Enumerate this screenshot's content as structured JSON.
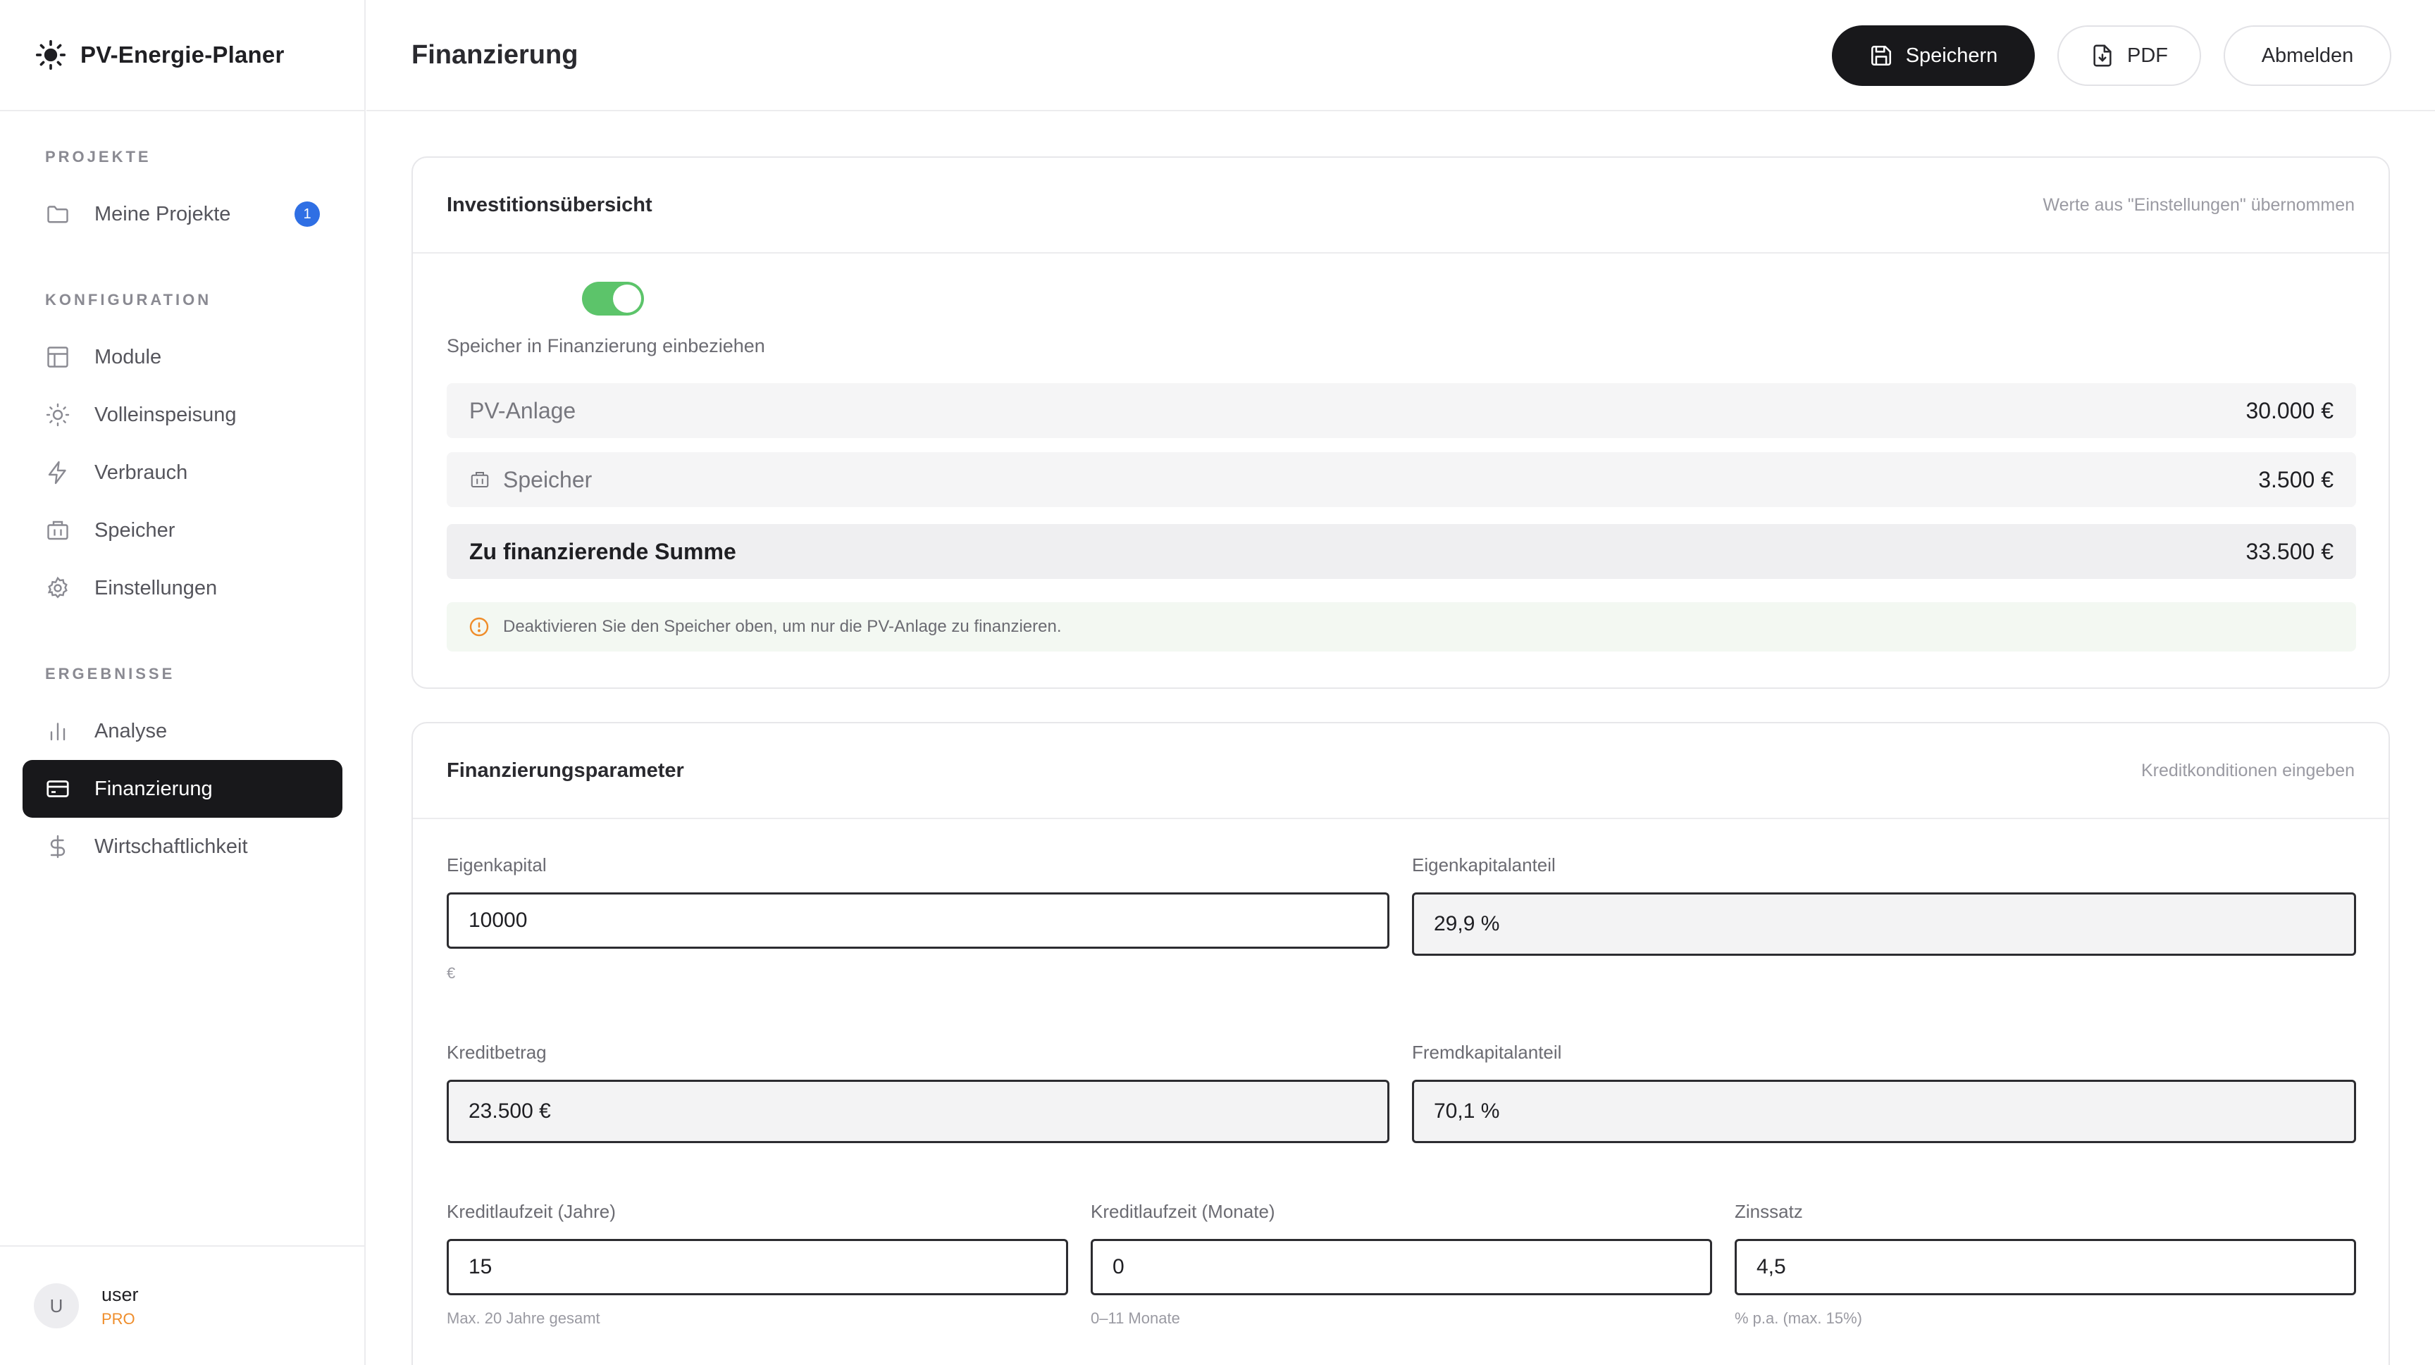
{
  "app": {
    "name": "PV-Energie-Planer"
  },
  "sidebar": {
    "sections": [
      {
        "label": "PROJEKTE"
      },
      {
        "label": "KONFIGURATION"
      },
      {
        "label": "ERGEBNISSE"
      }
    ],
    "items": [
      {
        "label": "Meine Projekte",
        "badge": "1"
      },
      {
        "label": "Module"
      },
      {
        "label": "Volleinspeisung"
      },
      {
        "label": "Verbrauch"
      },
      {
        "label": "Speicher"
      },
      {
        "label": "Einstellungen"
      },
      {
        "label": "Analyse"
      },
      {
        "label": "Finanzierung",
        "active": true
      },
      {
        "label": "Wirtschaftlichkeit"
      }
    ],
    "user": {
      "initial": "U",
      "name": "user",
      "plan": "PRO"
    }
  },
  "header": {
    "title": "Finanzierung",
    "save_label": "Speichern",
    "pdf_label": "PDF",
    "logout_label": "Abmelden"
  },
  "investment": {
    "title": "Investitionsübersicht",
    "subtitle": "Werte aus \"Einstellungen\" übernommen",
    "toggle_on": true,
    "toggle_label": "Speicher in Finanzierung einbeziehen",
    "rows": [
      {
        "label": "PV-Anlage",
        "value": "30.000 €"
      },
      {
        "label": "Speicher",
        "value": "3.500 €"
      },
      {
        "label": "Zu finanzierende Summe",
        "value": "33.500 €"
      }
    ],
    "note": "Deaktivieren Sie den Speicher oben, um nur die PV-Anlage zu finanzieren."
  },
  "params": {
    "title": "Finanzierungsparameter",
    "subtitle": "Kreditkonditionen eingeben",
    "equity": {
      "label": "Eigenkapital",
      "value": "10000",
      "hint": "€"
    },
    "equity_share": {
      "label": "Eigenkapitalanteil",
      "value": "29,9 %"
    },
    "loan": {
      "label": "Kreditbetrag",
      "value": "23.500 €"
    },
    "debt_share": {
      "label": "Fremdkapitalanteil",
      "value": "70,1 %"
    },
    "term_years": {
      "label": "Kreditlaufzeit (Jahre)",
      "value": "15",
      "hint": "Max. 20 Jahre gesamt"
    },
    "term_months": {
      "label": "Kreditlaufzeit (Monate)",
      "value": "0",
      "hint": "0–11 Monate"
    },
    "interest": {
      "label": "Zinssatz",
      "value": "4,5",
      "hint": "% p.a. (max. 15%)"
    }
  },
  "colors": {
    "active_nav": "#18181b",
    "badge": "#2f6fe4",
    "toggle": "#5cc46a",
    "plan": "#ef8d2a",
    "info_icon": "#ef8d2a"
  },
  "icons": {
    "brand": "sun-icon",
    "projects": "folder-icon",
    "modules": "layout-icon",
    "feed_in": "sun-icon",
    "consumption": "bolt-icon",
    "storage": "battery-icon",
    "settings": "gear-icon",
    "analysis": "bar-chart-icon",
    "financing": "credit-card-icon",
    "economics": "dollar-icon",
    "save": "save-icon",
    "pdf": "file-download-icon",
    "note": "info-icon"
  }
}
